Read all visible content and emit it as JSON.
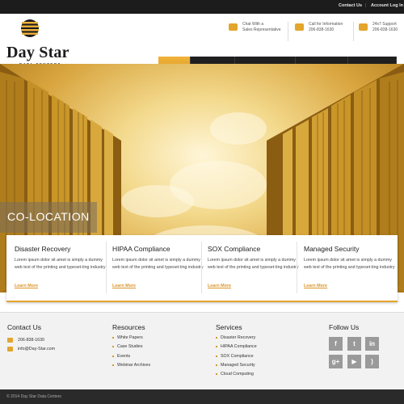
{
  "topbar": {
    "contact_label": "Contact Us",
    "login_label": "Account Log In",
    "separator": "|"
  },
  "brand": {
    "name": "Day Star",
    "tagline": "DATA CENTERS"
  },
  "header_info": [
    {
      "icon": "chat-icon",
      "line1": "Chat With a",
      "line2": "Sales Representative"
    },
    {
      "icon": "phone-icon",
      "line1": "Call for Information",
      "line2": "206-838-1630"
    },
    {
      "icon": "support-icon",
      "line1": "24x7 Support",
      "line2": "206-838-1630"
    }
  ],
  "nav": {
    "items": [
      {
        "label": "HOME",
        "active": true
      },
      {
        "label": "COLOCATION",
        "active": false
      },
      {
        "label": "MANAGED SERVICES",
        "active": false
      },
      {
        "label": "CLOUD SERVICES",
        "active": false
      },
      {
        "label": "GET A QUOTE",
        "active": false
      }
    ]
  },
  "hero": {
    "caption": "CO-LOCATION",
    "slides": 3,
    "active_slide": 1
  },
  "features": [
    {
      "title": "Disaster Recovery",
      "text": "Lorem ipsum dolor sit amet is simply a dummy web text of the printing and typeset-ting industry",
      "link": "Learn More"
    },
    {
      "title": "HIPAA Compliance",
      "text": "Lorem ipsum dolor sit amet is simply a dummy web text of the printing and typeset-ting industry",
      "link": "Learn More"
    },
    {
      "title": "SOX Compliance",
      "text": "Lorem ipsum dolor sit amet is simply a dummy web text of the printing and typeset-ting industry",
      "link": "Learn More"
    },
    {
      "title": "Managed Security",
      "text": "Lorem ipsum dolor sit amet is simply a dummy web text of the printing and typeset-ting industry",
      "link": "Learn More"
    }
  ],
  "footer": {
    "contact": {
      "title": "Contact Us",
      "phone": "206-838-1630",
      "email": "info@Day-Star.com"
    },
    "resources": {
      "title": "Resources",
      "items": [
        "White Papers",
        "Case Studies",
        "Events",
        "Webinar Archives"
      ]
    },
    "services": {
      "title": "Services",
      "items": [
        "Disaster Recovery",
        "HIPAA Compliance",
        "SOX Compliance",
        "Managed Security",
        "Cloud Computing"
      ]
    },
    "follow": {
      "title": "Follow Us",
      "networks": [
        {
          "icon": "facebook-icon",
          "glyph": "f"
        },
        {
          "icon": "twitter-icon",
          "glyph": "t"
        },
        {
          "icon": "linkedin-icon",
          "glyph": "in"
        },
        {
          "icon": "googleplus-icon",
          "glyph": "g+"
        },
        {
          "icon": "youtube-icon",
          "glyph": "▶"
        },
        {
          "icon": "rss-icon",
          "glyph": ")"
        }
      ]
    }
  },
  "copyright": "© 2014 Day Star Data Centers",
  "colors": {
    "accent": "#e3a52c",
    "dark": "#1c1c1c",
    "footer_bg": "#f2f2f2"
  }
}
